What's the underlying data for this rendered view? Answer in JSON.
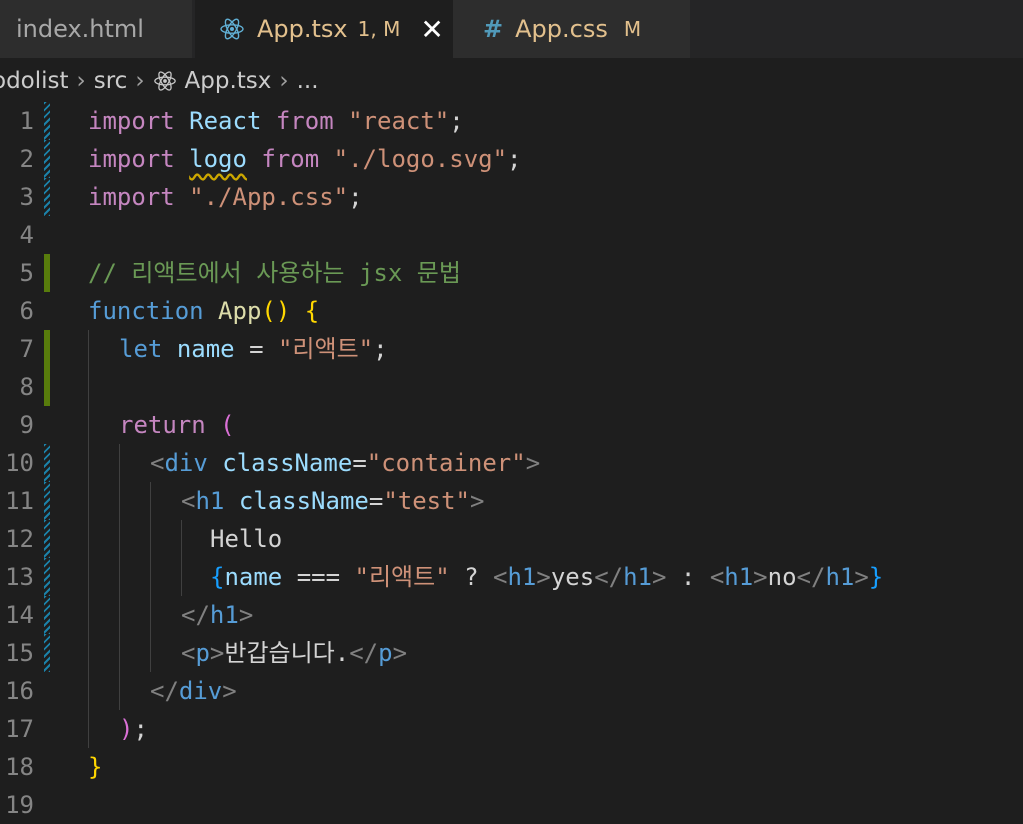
{
  "tabs": {
    "index": {
      "title": "index.html"
    },
    "app": {
      "title": "App.tsx",
      "status": "1, M",
      "close": "✕"
    },
    "css": {
      "icon": "#",
      "title": "App.css",
      "status": "M"
    }
  },
  "breadcrumb": {
    "folder": "odolist",
    "src": "src",
    "file": "App.tsx",
    "more": "..."
  },
  "code": {
    "l1": {
      "import": "import",
      "name": "React",
      "from": "from",
      "mod": "\"react\"",
      "semi": ";"
    },
    "l2": {
      "import": "import",
      "name": "logo",
      "from": "from",
      "mod": "\"./logo.svg\"",
      "semi": ";"
    },
    "l3": {
      "import": "import",
      "mod": "\"./App.css\"",
      "semi": ";"
    },
    "l5": {
      "comment": "// 리액트에서 사용하는 jsx 문법"
    },
    "l6": {
      "function": "function",
      "name": "App",
      "open": "(",
      "close": ")",
      "brace": "{"
    },
    "l7": {
      "let": "let",
      "name": "name",
      "eq": "=",
      "value": "\"리액트\"",
      "semi": ";"
    },
    "l9": {
      "return": "return",
      "paren": "("
    },
    "l10": {
      "tag": "div",
      "attr": "className",
      "eq": "=",
      "value": "\"container\""
    },
    "l11": {
      "tag": "h1",
      "attr": "className",
      "eq": "=",
      "value": "\"test\""
    },
    "l12": {
      "text": "Hello"
    },
    "l13": {
      "name": "name",
      "op": "===",
      "value": "\"리액트\"",
      "q": "?",
      "tag": "h1",
      "yes": "yes",
      "colon": ":",
      "no": "no"
    },
    "l14": {
      "tag": "h1"
    },
    "l15": {
      "tag": "p",
      "text": "반갑습니다."
    },
    "l16": {
      "tag": "div"
    },
    "l17": {
      "paren": ")",
      "semi": ";"
    },
    "l18": {
      "brace": "}"
    }
  },
  "line_numbers": [
    "1",
    "2",
    "3",
    "4",
    "5",
    "6",
    "7",
    "8",
    "9",
    "10",
    "11",
    "12",
    "13",
    "14",
    "15",
    "16",
    "17",
    "18",
    "19"
  ],
  "gutter": [
    "mod",
    "mod",
    "mod",
    "",
    "add",
    "",
    "add",
    "add",
    "",
    "mod",
    "mod",
    "mod",
    "mod",
    "mod",
    "mod",
    "",
    "",
    "",
    ""
  ],
  "colors": {
    "editor_bg": "#1e1e1e",
    "keyword": "#c586c0",
    "string": "#ce9178",
    "comment": "#6a9955"
  }
}
